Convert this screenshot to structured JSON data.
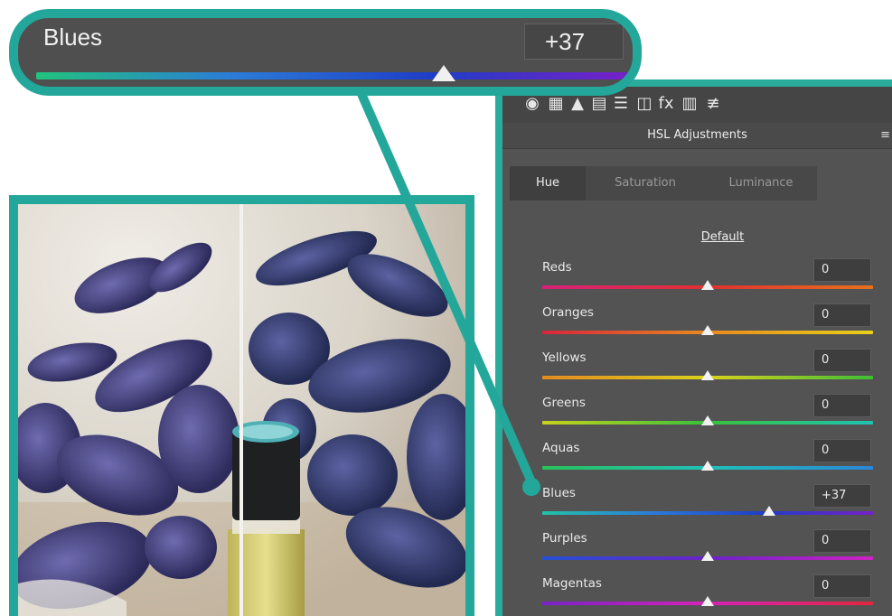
{
  "callout": {
    "label": "Blues",
    "value": "+37",
    "slider_fraction": 0.685,
    "gradient": [
      "#22c37e",
      "#2b7bd8",
      "#1f3dc7",
      "#7720c8"
    ]
  },
  "panel": {
    "title": "HSL Adjustments",
    "menu_icon": "≡",
    "toolbar": [
      {
        "name": "aperture-icon",
        "glyph": "◉"
      },
      {
        "name": "grid-icon",
        "glyph": "▦"
      },
      {
        "name": "mountain-icon",
        "glyph": "▲"
      },
      {
        "name": "hsl-icon",
        "glyph": "▤"
      },
      {
        "name": "split-tone-icon",
        "glyph": "☰"
      },
      {
        "name": "lens-icon",
        "glyph": "◫"
      },
      {
        "name": "fx-icon",
        "glyph": "fx"
      },
      {
        "name": "camera-calibration-icon",
        "glyph": "▥"
      },
      {
        "name": "presets-icon",
        "glyph": "≢"
      }
    ],
    "tabs": {
      "hue": "Hue",
      "saturation": "Saturation",
      "luminance": "Luminance"
    },
    "default_label": "Default",
    "sliders": [
      {
        "label": "Reds",
        "value": "0",
        "fraction": 0.5,
        "gradient": [
          "#d9207a",
          "#e23030",
          "#e6721d"
        ]
      },
      {
        "label": "Oranges",
        "value": "0",
        "fraction": 0.5,
        "gradient": [
          "#d8253a",
          "#e98a1f",
          "#e8d019"
        ]
      },
      {
        "label": "Yellows",
        "value": "0",
        "fraction": 0.5,
        "gradient": [
          "#e38a1e",
          "#dcd21c",
          "#3fbf35"
        ]
      },
      {
        "label": "Greens",
        "value": "0",
        "fraction": 0.5,
        "gradient": [
          "#c8d21c",
          "#38c23b",
          "#1fc2b3"
        ]
      },
      {
        "label": "Aquas",
        "value": "0",
        "fraction": 0.5,
        "gradient": [
          "#28c25a",
          "#1fc1b8",
          "#2a86d8"
        ]
      },
      {
        "label": "Blues",
        "value": "+37",
        "fraction": 0.685,
        "gradient": [
          "#22c2a8",
          "#2b7bd8",
          "#1f3dc7",
          "#7720c8"
        ]
      },
      {
        "label": "Purples",
        "value": "0",
        "fraction": 0.5,
        "gradient": [
          "#2550d4",
          "#6a23c7",
          "#cf22c4"
        ]
      },
      {
        "label": "Magentas",
        "value": "0",
        "fraction": 0.5,
        "gradient": [
          "#7a22c8",
          "#d622b8",
          "#e3263e"
        ]
      }
    ]
  },
  "accent_color": "#23a79a"
}
